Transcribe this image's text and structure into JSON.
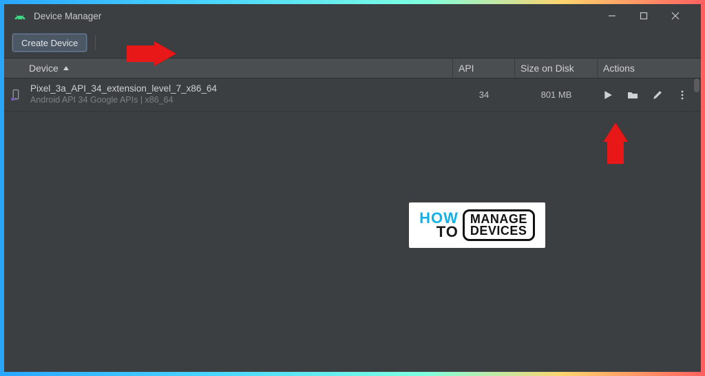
{
  "window": {
    "title": "Device Manager"
  },
  "toolbar": {
    "create_label": "Create Device"
  },
  "columns": {
    "device": "Device",
    "api": "API",
    "size": "Size on Disk",
    "actions": "Actions"
  },
  "devices": [
    {
      "name": "Pixel_3a_API_34_extension_level_7_x86_64",
      "subtitle": "Android API 34 Google APIs | x86_64",
      "api": "34",
      "size": "801 MB"
    }
  ],
  "watermark": {
    "how": "HOW",
    "to": "TO",
    "manage": "MANAGE",
    "devices": "DEVICES"
  }
}
